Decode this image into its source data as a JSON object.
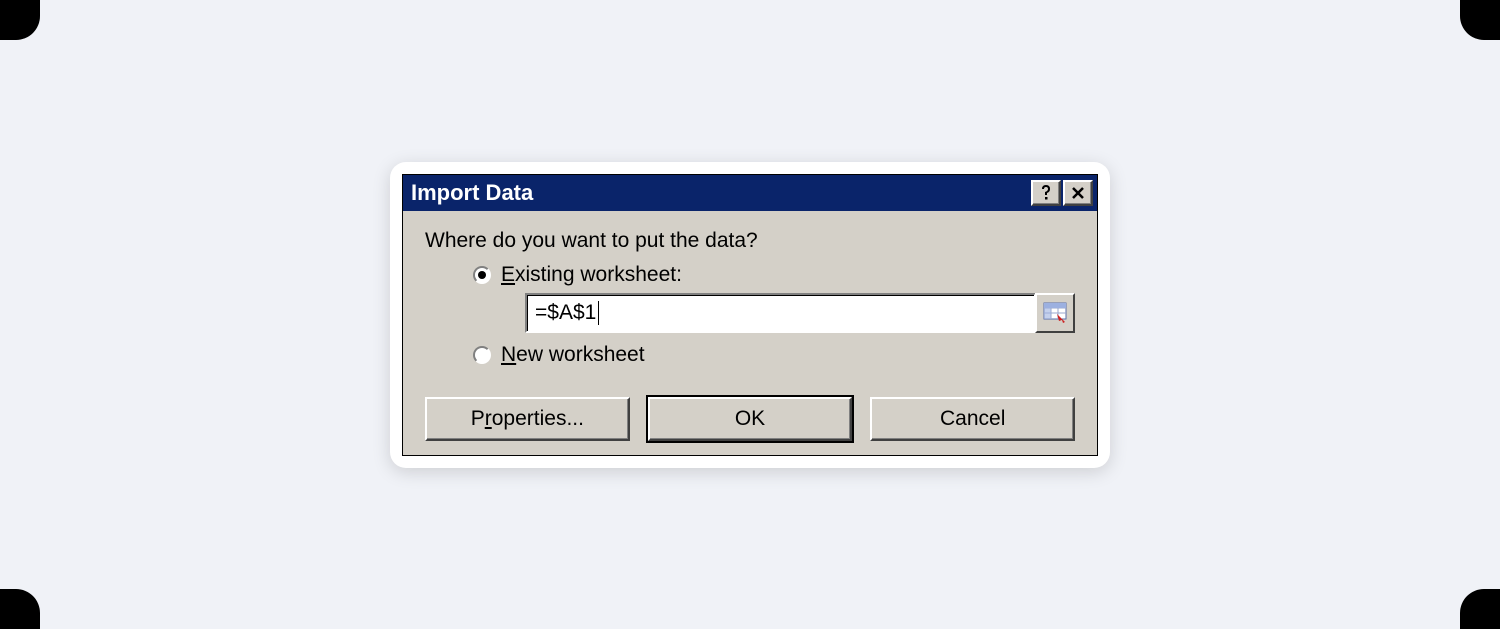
{
  "dialog": {
    "title": "Import Data",
    "prompt": "Where do you want to put the data?",
    "options": {
      "existing": {
        "label": "Existing worksheet:",
        "underline_index": 0,
        "selected": true
      },
      "new": {
        "label": "New worksheet",
        "underline_index": 0,
        "selected": false
      }
    },
    "cell_ref": "=$A$1",
    "buttons": {
      "properties": "Properties...",
      "ok": "OK",
      "cancel": "Cancel"
    }
  }
}
